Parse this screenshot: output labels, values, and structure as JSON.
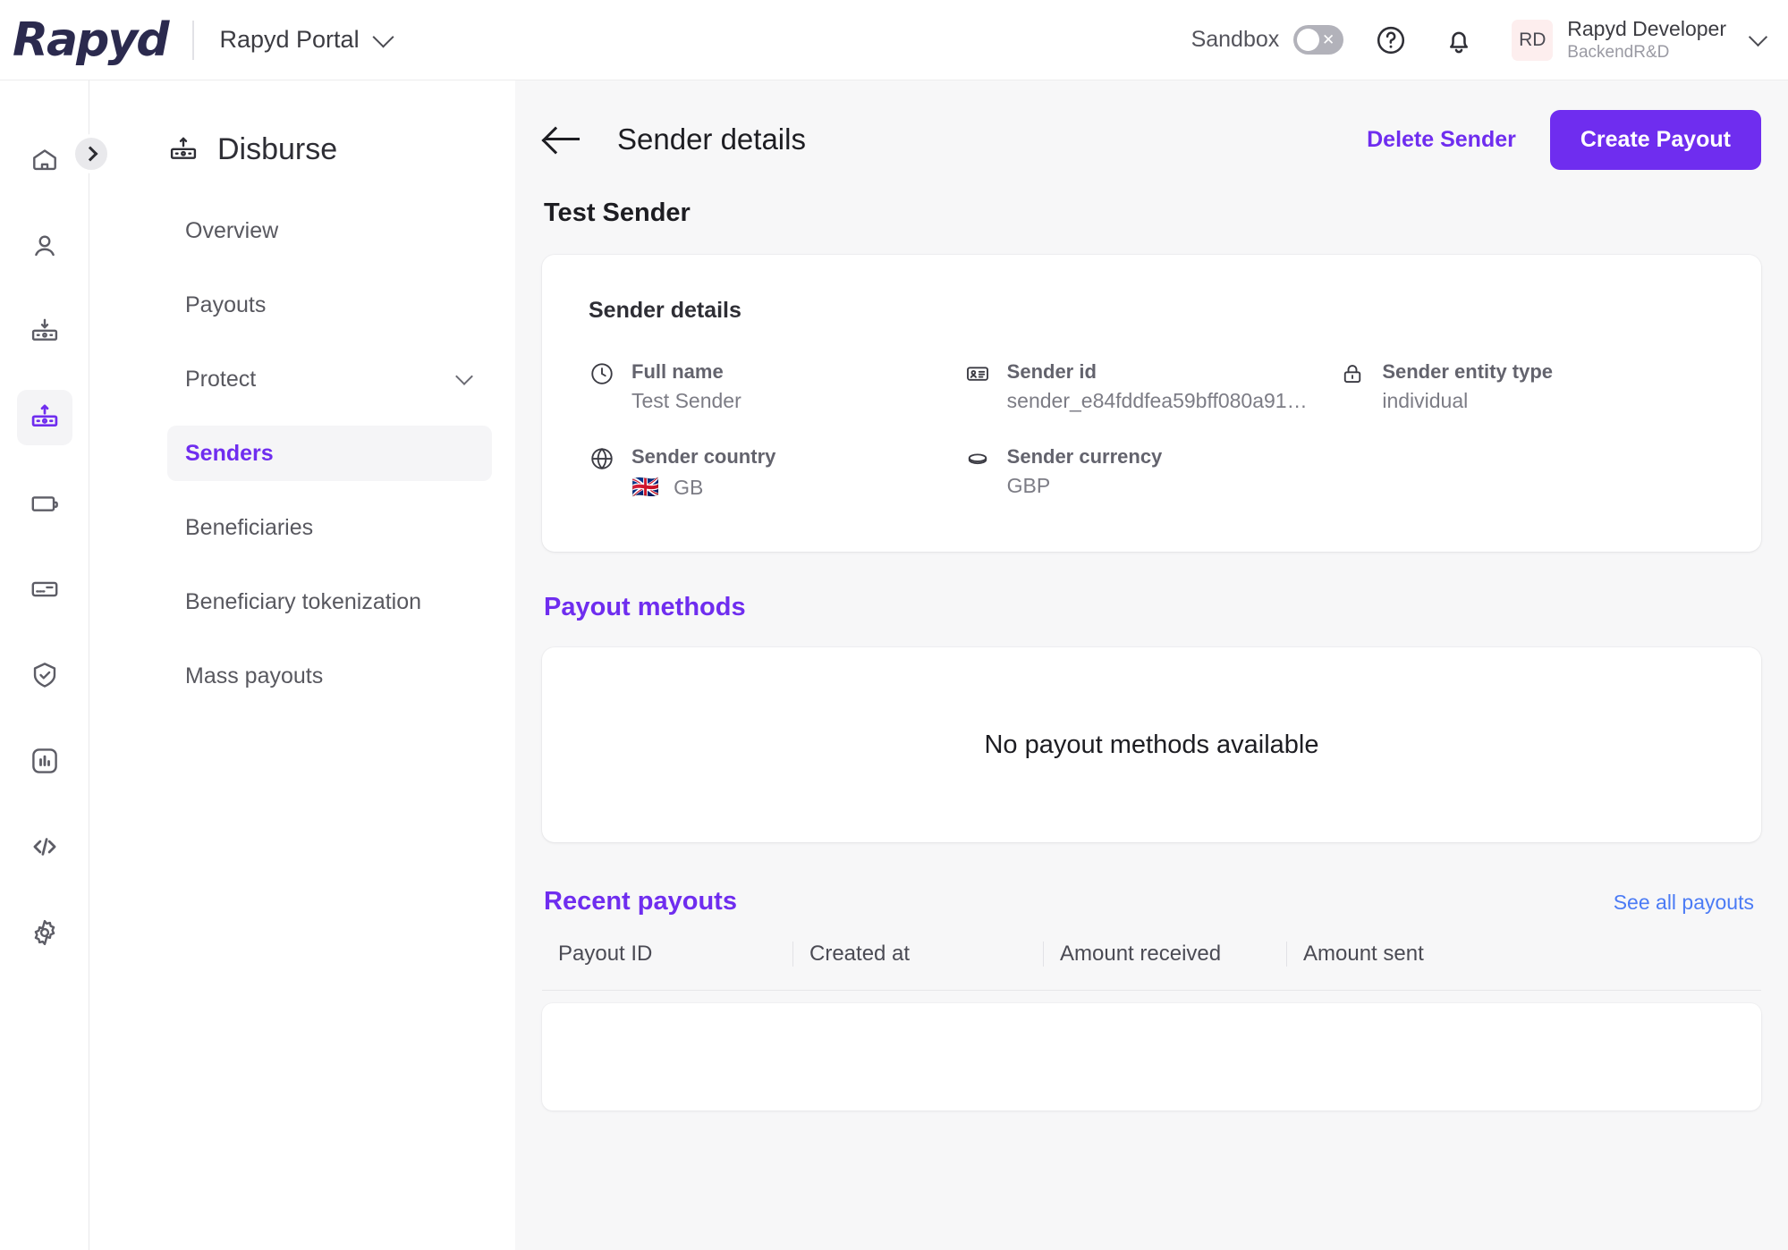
{
  "topbar": {
    "logo_text": "Rapyd",
    "portal_name": "Rapyd Portal",
    "sandbox_label": "Sandbox",
    "sandbox_on": false,
    "help_icon": "question-circle-icon",
    "notifications_icon": "bell-icon",
    "avatar_initials": "RD",
    "user_name": "Rapyd Developer",
    "user_org": "BackendR&D"
  },
  "rail": {
    "items": [
      {
        "icon": "home-icon",
        "active": false
      },
      {
        "icon": "person-icon",
        "active": false
      },
      {
        "icon": "collect-icon",
        "active": false
      },
      {
        "icon": "disburse-icon",
        "active": true
      },
      {
        "icon": "wallet-icon",
        "active": false
      },
      {
        "icon": "card-icon",
        "active": false
      },
      {
        "icon": "shield-check-icon",
        "active": false
      },
      {
        "icon": "analytics-icon",
        "active": false
      },
      {
        "icon": "code-icon",
        "active": false
      },
      {
        "icon": "gear-icon",
        "active": false
      }
    ]
  },
  "sidebar": {
    "section_title": "Disburse",
    "section_icon": "disburse-icon",
    "items": [
      {
        "label": "Overview",
        "active": false,
        "expandable": false
      },
      {
        "label": "Payouts",
        "active": false,
        "expandable": false
      },
      {
        "label": "Protect",
        "active": false,
        "expandable": true
      },
      {
        "label": "Senders",
        "active": true,
        "expandable": false
      },
      {
        "label": "Beneficiaries",
        "active": false,
        "expandable": false
      },
      {
        "label": "Beneficiary tokenization",
        "active": false,
        "expandable": false
      },
      {
        "label": "Mass payouts",
        "active": false,
        "expandable": false
      }
    ]
  },
  "page": {
    "back_icon": "arrow-left-icon",
    "title": "Sender details",
    "delete_label": "Delete Sender",
    "create_label": "Create Payout",
    "entity_name": "Test Sender"
  },
  "sender_details": {
    "card_title": "Sender details",
    "fields": [
      {
        "icon": "clock-icon",
        "label": "Full name",
        "value": "Test Sender"
      },
      {
        "icon": "id-card-icon",
        "label": "Sender id",
        "value": "sender_e84fddfea59bff080a91…"
      },
      {
        "icon": "lock-icon",
        "label": "Sender entity type",
        "value": "individual"
      },
      {
        "icon": "globe-icon",
        "label": "Sender country",
        "value": "GB",
        "flag": "🇬🇧"
      },
      {
        "icon": "coin-icon",
        "label": "Sender currency",
        "value": "GBP"
      }
    ]
  },
  "payout_methods": {
    "title": "Payout methods",
    "empty_text": "No payout methods available"
  },
  "recent_payouts": {
    "title": "Recent payouts",
    "see_all_label": "See all payouts",
    "columns": [
      "Payout ID",
      "Created at",
      "Amount received",
      "Amount sent"
    ],
    "rows": []
  },
  "colors": {
    "accent_purple": "#6F2DEF",
    "link_blue": "#4B7BF5",
    "logo_navy": "#2B2A4E",
    "avatar_bg": "#FDEEEE",
    "page_bg": "#F7F7F8"
  }
}
